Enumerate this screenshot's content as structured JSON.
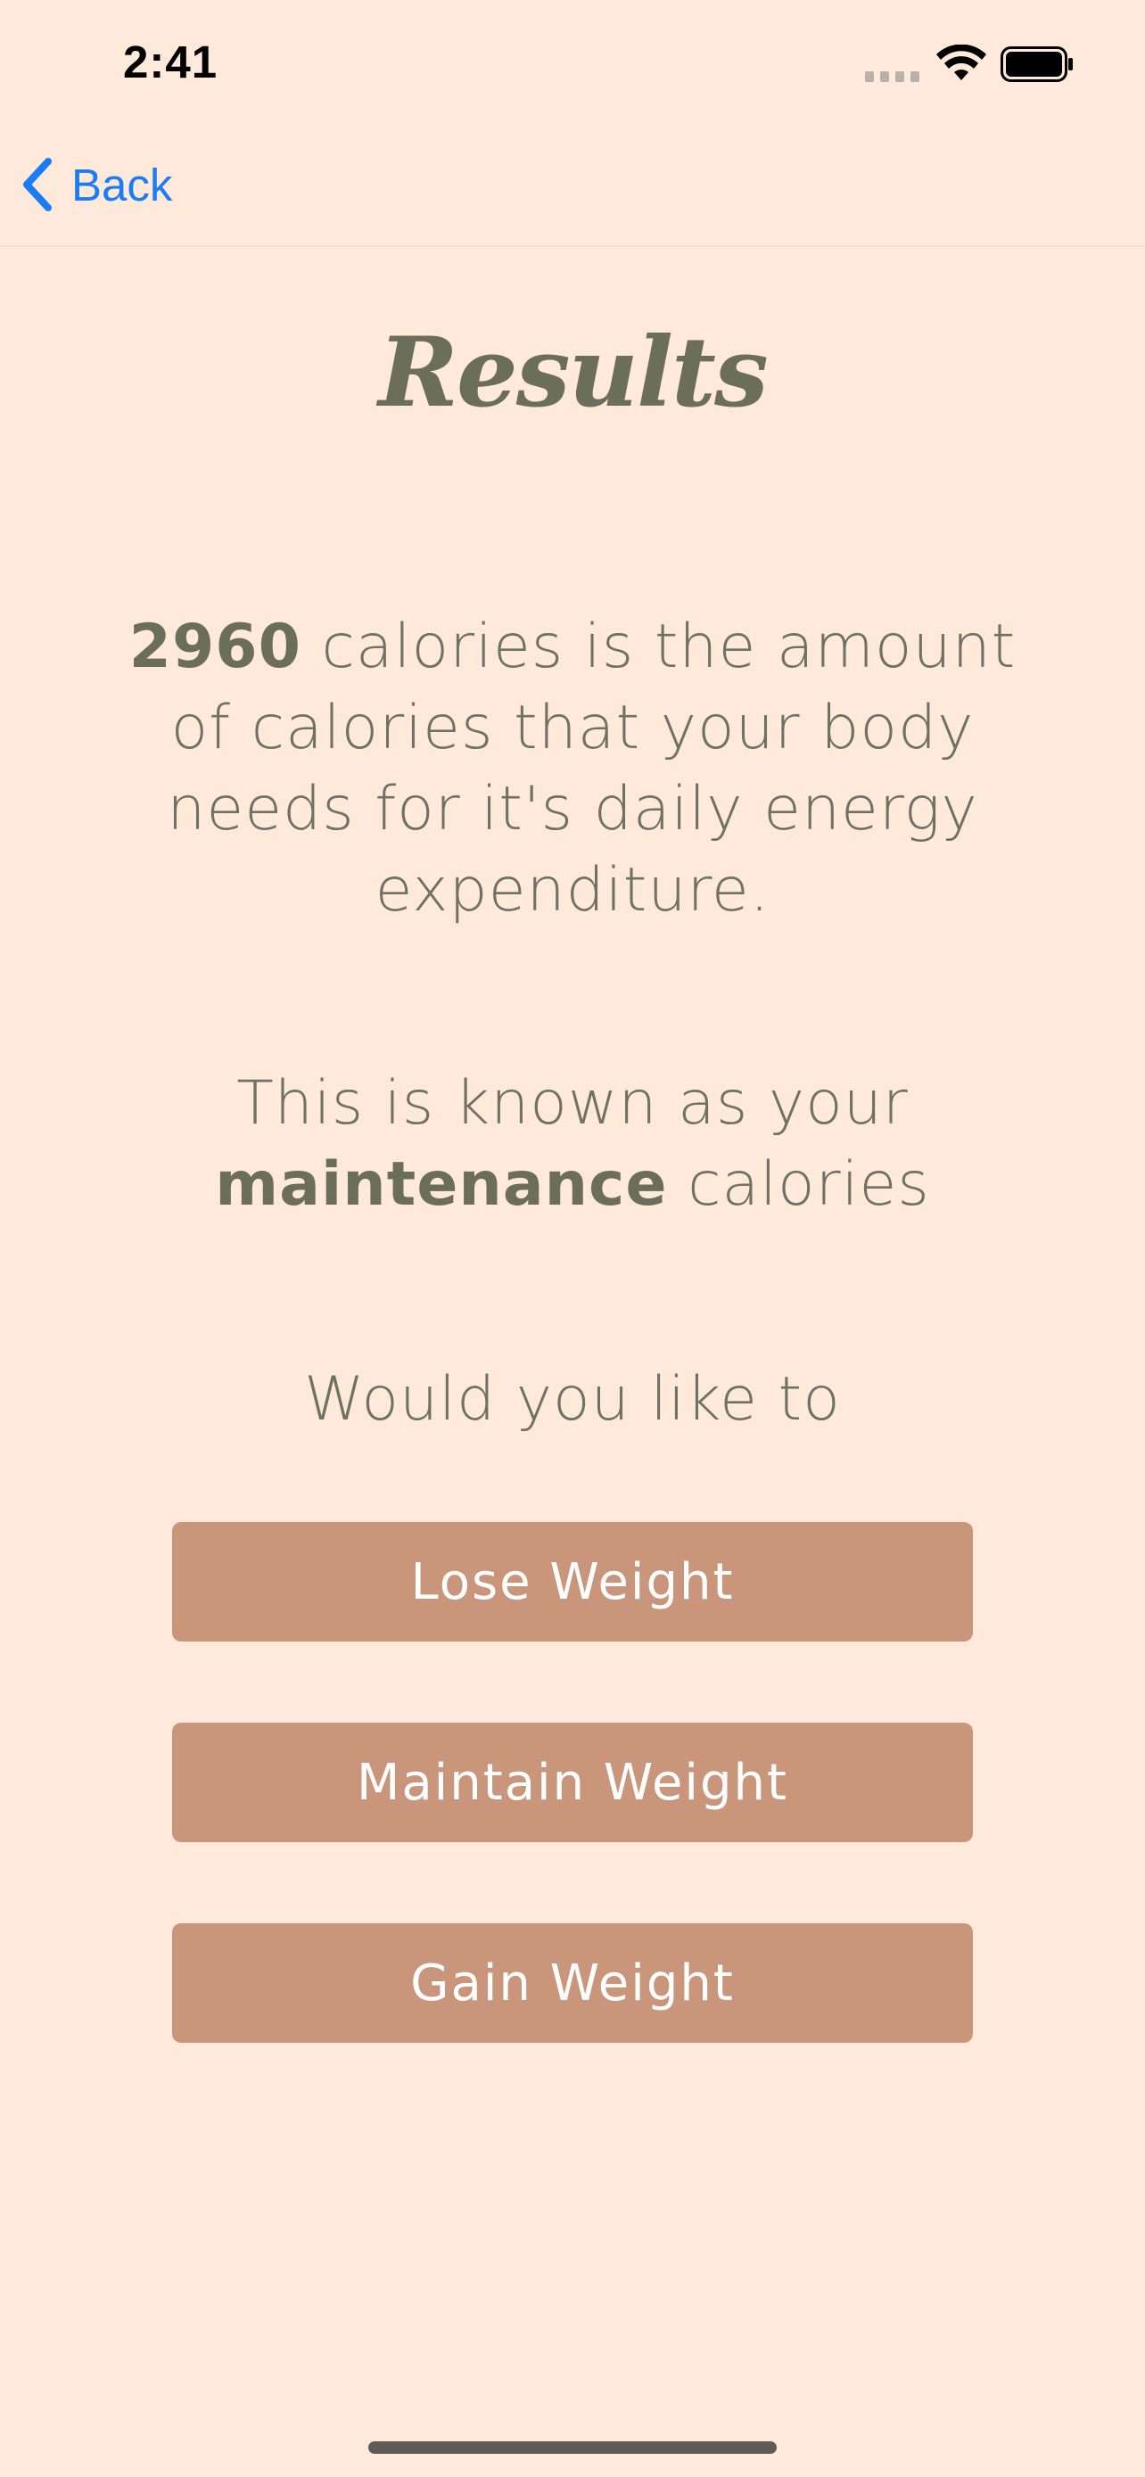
{
  "status_bar": {
    "time": "2:41",
    "icons": [
      "cellular-signal-icon",
      "wifi-icon",
      "battery-icon"
    ]
  },
  "nav": {
    "back_label": "Back",
    "back_icon": "chevron-left-icon",
    "accent_color": "#1A7CF6"
  },
  "title": "Results",
  "maintenance": {
    "calories_value": "2960",
    "calories_text": " calories is the amount of calories that your body needs for it's daily energy expenditure.",
    "known_as_prefix": "This is known as your ",
    "known_as_bold": "maintenance",
    "known_as_suffix": " calories"
  },
  "prompt": "Would you like to",
  "buttons": {
    "lose": "Lose Weight",
    "maintain": "Maintain Weight",
    "gain": "Gain Weight"
  },
  "colors": {
    "background": "#FEE9DA",
    "text": "#6B6E58",
    "button": "#C9967C",
    "button_text": "#FFFFFF"
  }
}
